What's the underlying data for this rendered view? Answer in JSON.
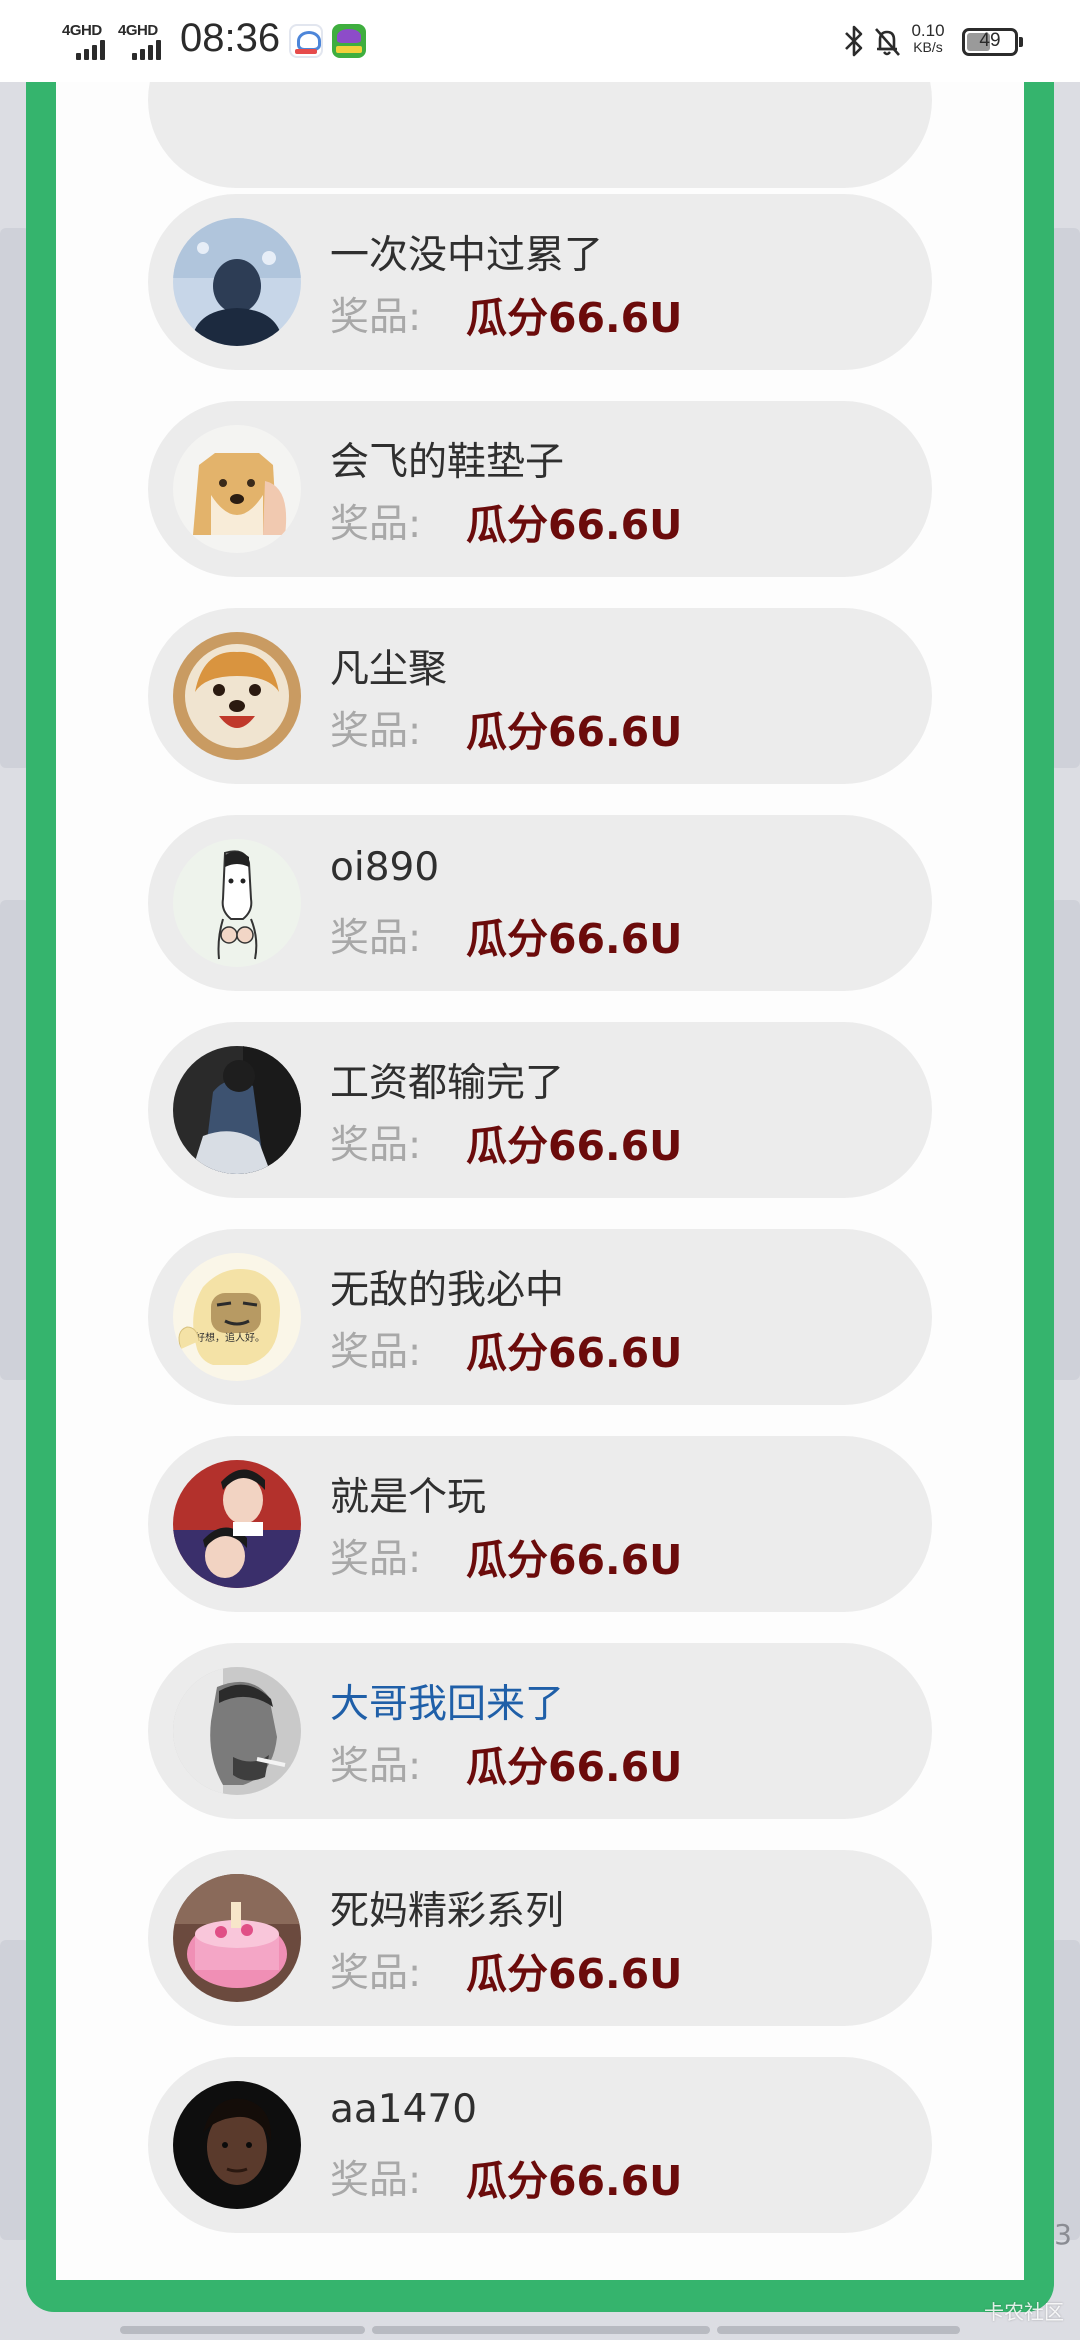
{
  "status_bar": {
    "signal_1": "4GHD",
    "signal_2": "4GHD",
    "time": "08:36",
    "net_speed_value": "0.10",
    "net_speed_unit": "KB/s",
    "battery": "49",
    "battery_level": 0.49,
    "icons": [
      "app-icon-1",
      "app-icon-2",
      "bluetooth-icon",
      "mute-icon",
      "battery-icon"
    ]
  },
  "winners": {
    "prize_label": "奖品:",
    "items": [
      {
        "name": "一次没中过累了",
        "prize": "瓜分66.6U"
      },
      {
        "name": "会飞的鞋垫子",
        "prize": "瓜分66.6U"
      },
      {
        "name": "凡尘聚",
        "prize": "瓜分66.6U"
      },
      {
        "name": "oi890",
        "prize": "瓜分66.6U"
      },
      {
        "name": "工资都输完了",
        "prize": "瓜分66.6U"
      },
      {
        "name": "无敌的我必中",
        "prize": "瓜分66.6U"
      },
      {
        "name": "就是个玩",
        "prize": "瓜分66.6U"
      },
      {
        "name": "大哥我回来了",
        "prize": "瓜分66.6U"
      },
      {
        "name": "死妈精彩系列",
        "prize": "瓜分66.6U"
      },
      {
        "name": "aa1470",
        "prize": "瓜分66.6U"
      }
    ]
  },
  "background": {
    "side_number": "3",
    "watermark": "卡农社区"
  },
  "colors": {
    "modal_border": "#35b46d",
    "prize_value": "#6b0b0b",
    "highlight_name": "#1f5fa8"
  }
}
